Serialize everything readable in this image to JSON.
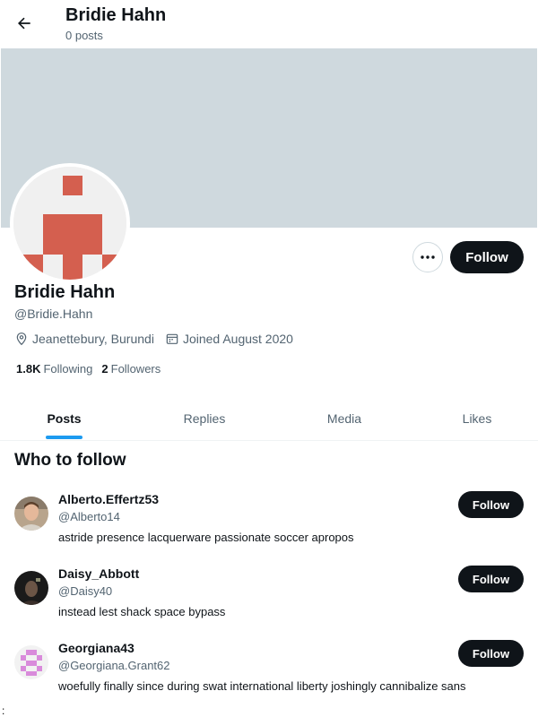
{
  "header": {
    "title": "Bridie Hahn",
    "subtitle": "0 posts"
  },
  "profile": {
    "name": "Bridie Hahn",
    "handle": "@Bridie.Hahn",
    "location": "Jeanettebury, Burundi",
    "joined": "Joined August 2020",
    "following_count": "1.8K",
    "following_label": "Following",
    "followers_count": "2",
    "followers_label": "Followers",
    "follow_label": "Follow",
    "more_label": "···"
  },
  "tabs": [
    {
      "label": "Posts"
    },
    {
      "label": "Replies"
    },
    {
      "label": "Media"
    },
    {
      "label": "Likes"
    }
  ],
  "who_to_follow": {
    "title": "Who to follow",
    "users": [
      {
        "name": "Alberto.Effertz53",
        "handle": "@Alberto14",
        "bio": "astride presence lacquerware passionate soccer apropos",
        "follow_label": "Follow"
      },
      {
        "name": "Daisy_Abbott",
        "handle": "@Daisy40",
        "bio": "instead lest shack space bypass",
        "follow_label": "Follow"
      },
      {
        "name": "Georgiana43",
        "handle": "@Georgiana.Grant62",
        "bio": "woefully finally since during swat international liberty joshingly cannibalize sans",
        "follow_label": "Follow"
      }
    ]
  },
  "colors": {
    "banner": "#cfd9de",
    "avatar_pattern": "#d45f4f",
    "accent": "#1d9bf0",
    "button": "#0f1419"
  },
  "misc": {
    "edge_mark": ":"
  }
}
